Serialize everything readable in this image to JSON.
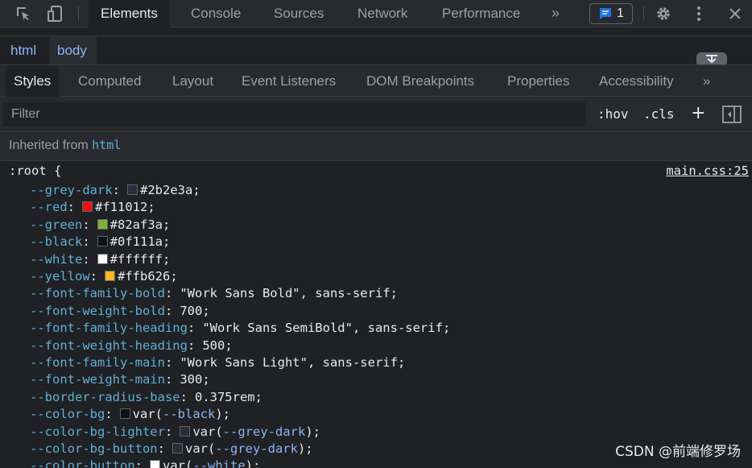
{
  "toolbar": {
    "tabs": [
      "Elements",
      "Console",
      "Sources",
      "Network",
      "Performance"
    ],
    "overflow_glyph": "»",
    "issues_count": "1",
    "icons": [
      "inspect-element-icon",
      "device-toggle-icon",
      "issues-icon",
      "settings-gear-icon",
      "more-options-icon",
      "close-icon"
    ]
  },
  "breadcrumb": [
    "html",
    "body"
  ],
  "panel_tabs": {
    "items": [
      "Styles",
      "Computed",
      "Layout",
      "Event Listeners",
      "DOM Breakpoints",
      "Properties",
      "Accessibility"
    ],
    "overflow_glyph": "»"
  },
  "filter": {
    "placeholder": "Filter",
    "value": "",
    "hov": ":hov",
    "cls": ".cls",
    "add_rule_glyph": "+"
  },
  "inherited": {
    "label": "Inherited from",
    "element": "html"
  },
  "rule": {
    "selector": ":root {",
    "source": "main.css:25",
    "declarations": [
      {
        "prop": "--grey-dark",
        "swatch": "#2b2e3a",
        "value": "#2b2e3a",
        "ref": ""
      },
      {
        "prop": "--red",
        "swatch": "#f11012",
        "value": "#f11012",
        "ref": ""
      },
      {
        "prop": "--green",
        "swatch": "#82af3a",
        "value": "#82af3a",
        "ref": ""
      },
      {
        "prop": "--black",
        "swatch": "#0f111a",
        "value": "#0f111a",
        "ref": ""
      },
      {
        "prop": "--white",
        "swatch": "#ffffff",
        "value": "#ffffff",
        "ref": ""
      },
      {
        "prop": "--yellow",
        "swatch": "#ffb626",
        "value": "#ffb626",
        "ref": ""
      },
      {
        "prop": "--font-family-bold",
        "swatch": "",
        "value": "\"Work Sans Bold\", sans-serif",
        "ref": ""
      },
      {
        "prop": "--font-weight-bold",
        "swatch": "",
        "value": "700",
        "ref": ""
      },
      {
        "prop": "--font-family-heading",
        "swatch": "",
        "value": "\"Work Sans SemiBold\", sans-serif",
        "ref": ""
      },
      {
        "prop": "--font-weight-heading",
        "swatch": "",
        "value": "500",
        "ref": ""
      },
      {
        "prop": "--font-family-main",
        "swatch": "",
        "value": "\"Work Sans Light\", sans-serif",
        "ref": ""
      },
      {
        "prop": "--font-weight-main",
        "swatch": "",
        "value": "300",
        "ref": ""
      },
      {
        "prop": "--border-radius-base",
        "swatch": "",
        "value": "0.375rem",
        "ref": ""
      },
      {
        "prop": "--color-bg",
        "swatch": "#0f111a",
        "value": "",
        "ref": "--black"
      },
      {
        "prop": "--color-bg-lighter",
        "swatch": "#2b2e3a",
        "value": "",
        "ref": "--grey-dark"
      },
      {
        "prop": "--color-bg-button",
        "swatch": "#2b2e3a",
        "value": "",
        "ref": "--grey-dark"
      },
      {
        "prop": "--color-button",
        "swatch": "#ffffff",
        "value": "",
        "ref": "--white"
      }
    ]
  },
  "watermark": "CSDN @前端修罗场"
}
